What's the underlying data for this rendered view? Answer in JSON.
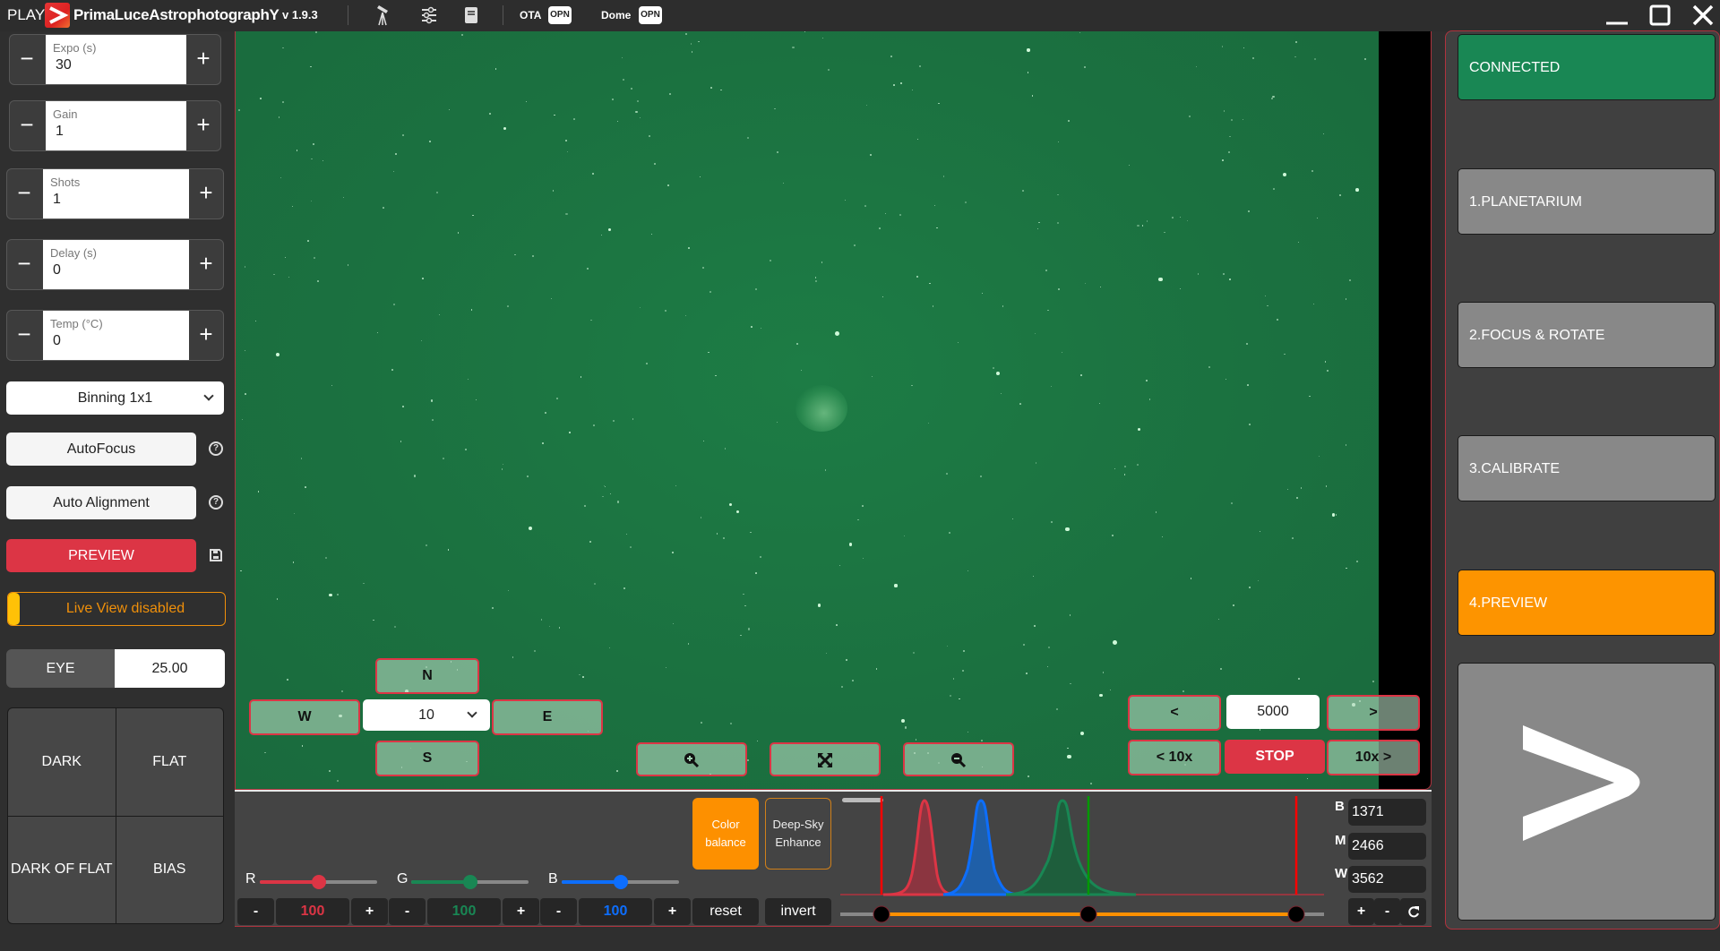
{
  "titlebar": {
    "play": "PLAY",
    "app_name": "PrimaLuceAstrophotographY",
    "version": "v 1.9.3",
    "icons": [
      "telescope-icon",
      "sliders-icon",
      "book-icon"
    ],
    "ota_label": "OTA",
    "ota_status": "OPN",
    "dome_label": "Dome",
    "dome_status": "OPN",
    "window_controls": [
      "minimize",
      "maximize",
      "close"
    ]
  },
  "left": {
    "steppers": [
      {
        "label": "Expo (s)",
        "value": "30"
      },
      {
        "label": "Gain",
        "value": "1"
      },
      {
        "label": "Shots",
        "value": "1"
      },
      {
        "label": "Delay (s)",
        "value": "0"
      },
      {
        "label": "Temp (°C)",
        "value": "0"
      }
    ],
    "minus": "−",
    "plus": "+",
    "binning": "Binning 1x1",
    "autofocus": "AutoFocus",
    "auto_alignment": "Auto Alignment",
    "help": "?",
    "preview": "PREVIEW",
    "live_view": "Live View disabled",
    "eye_label": "EYE",
    "eye_value": "25.00",
    "calibration": [
      "DARK",
      "FLAT",
      "DARK OF FLAT",
      "BIAS"
    ]
  },
  "viewer": {
    "north": "N",
    "south": "S",
    "west": "W",
    "east": "E",
    "step_value": "10",
    "zoom_in_icon": "zoom-in-icon",
    "fit_icon": "expand-icon",
    "zoom_out_icon": "zoom-out-icon",
    "focus_prev": "<",
    "focus_value": "5000",
    "focus_next": ">",
    "focus_prev10": "< 10x",
    "focus_stop": "STOP",
    "focus_next10": "10x >"
  },
  "bottom": {
    "r_label": "R",
    "g_label": "G",
    "b_label": "B",
    "r_value": "100",
    "g_value": "100",
    "b_value": "100",
    "r_slider_fraction": 0.5,
    "g_slider_fraction": 0.5,
    "b_slider_fraction": 0.5,
    "minus": "-",
    "plus": "+",
    "color_balance": "Color balance",
    "deep_sky": "Deep-Sky Enhance",
    "reset": "reset",
    "invert": "invert",
    "histogram": {
      "black_label": "B",
      "black_value": "1371",
      "mid_label": "M",
      "mid_value": "2466",
      "white_label": "W",
      "white_value": "3562",
      "zoom_plus": "+",
      "zoom_minus": "-",
      "reset_icon": "refresh-icon"
    },
    "colors": {
      "red": "#dc3545",
      "green": "#198754",
      "blue": "#0d6efd",
      "orange": "#fd9000"
    }
  },
  "right": {
    "connected": "CONNECTED",
    "steps": [
      "1.PLANETARIUM",
      "2.FOCUS & ROTATE",
      "3.CALIBRATE",
      "4.PREVIEW"
    ],
    "active_step": "4.PREVIEW",
    "next_icon": "next-arrow-icon",
    "colors": {
      "connected": "#198754",
      "inactive": "#888888",
      "active": "#fd9400"
    }
  }
}
